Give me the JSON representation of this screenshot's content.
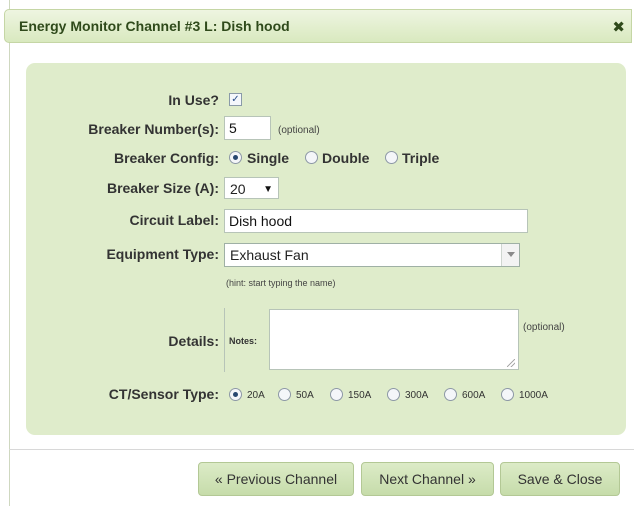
{
  "dialog": {
    "title": "Energy Monitor Channel #3 L: Dish hood",
    "close_glyph": "✖"
  },
  "form": {
    "in_use": {
      "label": "In Use?",
      "checked": true,
      "check_glyph": "✓"
    },
    "breaker_numbers": {
      "label": "Breaker Number(s):",
      "value": "5",
      "hint": "(optional)"
    },
    "breaker_config": {
      "label": "Breaker Config:",
      "options": [
        "Single",
        "Double",
        "Triple"
      ],
      "selected": "Single"
    },
    "breaker_size": {
      "label": "Breaker Size (A):",
      "value": "20",
      "arrow_glyph": "▼"
    },
    "circuit_label": {
      "label": "Circuit Label:",
      "value": "Dish hood"
    },
    "equipment_type": {
      "label": "Equipment Type:",
      "value": "Exhaust Fan",
      "hint": "(hint: start typing the name)"
    },
    "details": {
      "label": "Details:",
      "notes_label": "Notes:",
      "notes_value": "",
      "hint": "(optional)"
    },
    "ct_sensor_type": {
      "label": "CT/Sensor Type:",
      "options": [
        "20A",
        "50A",
        "150A",
        "300A",
        "600A",
        "1000A"
      ],
      "selected": "20A"
    }
  },
  "footer": {
    "previous_label": "« Previous Channel",
    "next_label": "Next Channel »",
    "save_label": "Save & Close"
  },
  "colors": {
    "panel_bg": "#dfeccb",
    "title_color": "#2f4a1b",
    "button_bg": "#c6dcaa"
  }
}
